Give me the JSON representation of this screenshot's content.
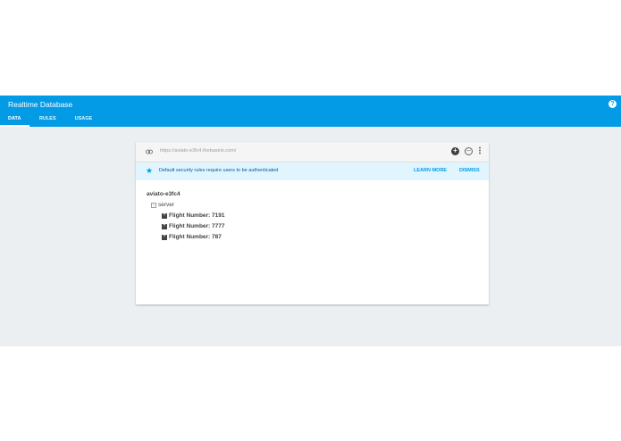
{
  "header": {
    "title": "Realtime Database",
    "help_icon": "help-icon",
    "tabs": [
      {
        "label": "DATA",
        "active": true
      },
      {
        "label": "RULES",
        "active": false
      },
      {
        "label": "USAGE",
        "active": false
      }
    ],
    "color": "#039be5"
  },
  "urlbar": {
    "url": "https://aviato-e3fc4.firebaseio.com/",
    "icons": [
      "link-icon",
      "add-circle-icon",
      "remove-circle-icon",
      "more-vert-icon"
    ]
  },
  "banner": {
    "text": "Default security rules require users to be authenticated",
    "learn_more": "LEARN MORE",
    "dismiss": "DISMISS"
  },
  "tree": {
    "root": "aviato-e3fc4",
    "server": {
      "key": "server",
      "expanded": true
    },
    "children": [
      {
        "key": "Flight Number:",
        "value": "7191"
      },
      {
        "key": "Flight Number:",
        "value": "7777"
      },
      {
        "key": "Flight Number:",
        "value": "787"
      }
    ]
  }
}
